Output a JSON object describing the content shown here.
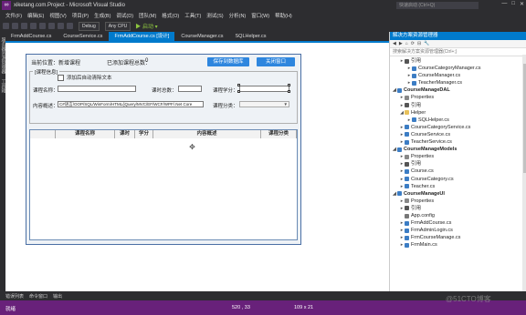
{
  "window": {
    "title": "xiketang.com.Project - Microsoft Visual Studio",
    "quick_launch": "快速启动 (Ctrl+Q)",
    "win_buttons": [
      "—",
      "□",
      "✕"
    ]
  },
  "menu": [
    "文件(F)",
    "编辑(E)",
    "视图(V)",
    "项目(P)",
    "生成(B)",
    "调试(D)",
    "团队(M)",
    "格式(O)",
    "工具(T)",
    "测试(S)",
    "分析(N)",
    "窗口(W)",
    "帮助(H)"
  ],
  "toolbar": {
    "config": "Debug",
    "platform": "Any CPU",
    "start": "▶ 启动 ▾"
  },
  "left_tabs": [
    "服务器资源管理器",
    "工具箱"
  ],
  "doc_tabs": [
    {
      "label": "FrmAddCourse.cs"
    },
    {
      "label": "CourseService.cs"
    },
    {
      "label": "FrmAddCourse.cs [设计]",
      "active": true
    },
    {
      "label": "CourseManager.cs"
    },
    {
      "label": "SQLHelper.cs"
    }
  ],
  "form": {
    "pos_label": "当前位置：新增课程",
    "count_label": "已添加课程总数：",
    "count_value": "0",
    "save_btn": "保存到数据库",
    "close_btn": "关闭窗口",
    "group_title": "[课程信息]",
    "checkbox_label": "添加后自动清除文本",
    "name_label": "课程名称：",
    "hours_label": "课时总数：",
    "credit_label": "课程学分：",
    "desc_label": "内容概述：",
    "desc_value": "C#语言/OOP/SQL/WinForm/HTML/jQuery/MVC/EF/WCF/WPF/.Net Core",
    "category_label": "课程分类：",
    "columns": [
      "课程名称",
      "课时",
      "学分",
      "内容概述",
      "课程分类"
    ]
  },
  "solution": {
    "title": "解决方案资源管理器",
    "search_placeholder": "搜索解决方案资源管理器(Ctrl+;)",
    "items": [
      {
        "text": "引用",
        "twist": "▸",
        "color": "#555"
      },
      {
        "text": "CourseCategoryManager.cs",
        "twist": "▸",
        "color": "#3c7dc4"
      },
      {
        "text": "CourseManager.cs",
        "twist": "▸",
        "color": "#3c7dc4"
      },
      {
        "text": "TeacherManager.cs",
        "twist": "▸",
        "color": "#3c7dc4"
      },
      {
        "text": "CourseManageDAL",
        "twist": "◢",
        "color": "#3c7dc4"
      },
      {
        "text": "Properties",
        "twist": "▸",
        "color": "#888"
      },
      {
        "text": "引用",
        "twist": "▸",
        "color": "#555"
      },
      {
        "text": "Helper",
        "twist": "◢",
        "color": "#e8c15a"
      },
      {
        "text": "SQLHelper.cs",
        "twist": "▸",
        "color": "#3c7dc4"
      },
      {
        "text": "CourseCategoryService.cs",
        "twist": "▸",
        "color": "#3c7dc4"
      },
      {
        "text": "CourseService.cs",
        "twist": "▸",
        "color": "#3c7dc4"
      },
      {
        "text": "TeacherService.cs",
        "twist": "▸",
        "color": "#3c7dc4"
      },
      {
        "text": "CourseManageModels",
        "twist": "◢",
        "color": "#3c7dc4"
      },
      {
        "text": "Properties",
        "twist": "▸",
        "color": "#888"
      },
      {
        "text": "引用",
        "twist": "▸",
        "color": "#555"
      },
      {
        "text": "Course.cs",
        "twist": "▸",
        "color": "#3c7dc4"
      },
      {
        "text": "CourseCategory.cs",
        "twist": "▸",
        "color": "#3c7dc4"
      },
      {
        "text": "Teacher.cs",
        "twist": "▸",
        "color": "#3c7dc4"
      },
      {
        "text": "CourseManageUI",
        "twist": "◢",
        "color": "#3c7dc4"
      },
      {
        "text": "Properties",
        "twist": "▸",
        "color": "#888"
      },
      {
        "text": "引用",
        "twist": "▸",
        "color": "#555"
      },
      {
        "text": "App.config",
        "twist": "",
        "color": "#777"
      },
      {
        "text": "FrmAddCourse.cs",
        "twist": "▸",
        "color": "#3c7dc4"
      },
      {
        "text": "FrmAdminLogin.cs",
        "twist": "▸",
        "color": "#3c7dc4"
      },
      {
        "text": "FrmCourseManage.cs",
        "twist": "▸",
        "color": "#3c7dc4"
      },
      {
        "text": "FrmMain.cs",
        "twist": "▸",
        "color": "#3c7dc4"
      }
    ]
  },
  "status_tabs": [
    "错误列表",
    "命令窗口",
    "输出"
  ],
  "status": {
    "ready": "就绪",
    "pos": "520 , 33",
    "size": "109 x 21"
  },
  "watermark": "@51CTO博客"
}
